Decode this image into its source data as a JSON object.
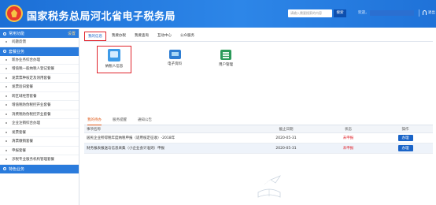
{
  "header": {
    "title": "国家税务总局河北省电子税务局",
    "search_placeholder": "请输入需要搜索的内容",
    "search_button": "搜索",
    "welcome": "欢迎，",
    "exit": "退出"
  },
  "sidebar": {
    "head1": "常用功能",
    "head1_right": "设置",
    "items1": [
      "问题反馈"
    ],
    "head2": "套餐业务",
    "items2": [
      "新办业务综合办理",
      "增值税一般纳税人登记套餐",
      "发票票种核定及领用套餐",
      "发票验旧套餐",
      "跨区域经营套餐",
      "增值税防伪税控开业套餐",
      "消费税防伪税控开业套餐",
      "企业注销综合办理",
      "发票套餐",
      "清票缴销套餐",
      "申报套餐",
      "涉税专业服务机构管理套餐"
    ],
    "head3": "特色业务"
  },
  "tabs": [
    "我的信息",
    "我要办税",
    "我要查询",
    "互动中心",
    "公众服务"
  ],
  "tiles": [
    "纳税人信息",
    "电子资料",
    "用户管理"
  ],
  "todo": {
    "tabs": [
      "我的待办",
      "服务提醒",
      "通知公告"
    ],
    "headers": [
      "事项名称",
      "截止日期",
      "状态",
      "操作"
    ],
    "rows": [
      {
        "name": "居民企业所得税年度纳税申报（适用核定征收）-2018年",
        "date": "2020-05-31",
        "status": "未申报",
        "action": "办理"
      },
      {
        "name": "财务报表报送与信息采集（小企业会计准则）申报",
        "date": "2020-05-31",
        "status": "未申报",
        "action": "办理"
      }
    ]
  }
}
